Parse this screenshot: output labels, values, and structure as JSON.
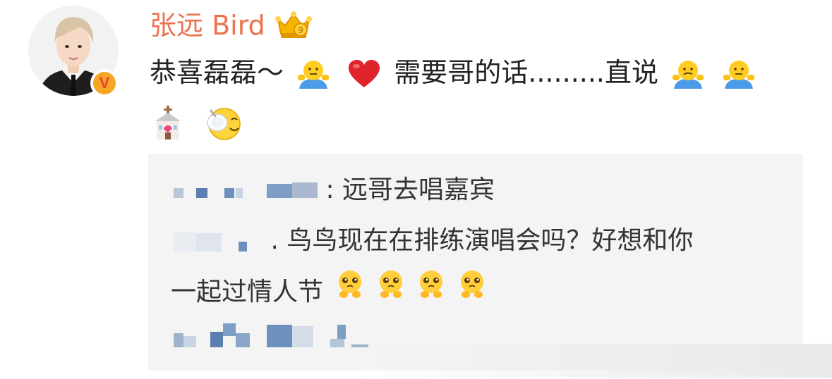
{
  "post": {
    "author": "张远 Bird",
    "text_line1_a": "恭喜磊磊～",
    "text_line1_b": "需要哥的话.........直说",
    "icons": {
      "crown": "crown-badge-icon",
      "verified": "verified-v-icon",
      "shrug": "shrug-emoji-icon",
      "heart": "red-heart-icon",
      "wedding": "wedding-chapel-icon",
      "eating": "eating-emoji-icon"
    },
    "verified_label": "V"
  },
  "repost": {
    "comment1_text": ": 远哥去唱嘉宾",
    "comment2_text_line1": ". 鸟鸟现在在排练演唱会吗？好想和你",
    "comment2_text_line2": "一起过情人节",
    "pleading_icon": "pleading-emoji-icon"
  },
  "colors": {
    "username": "#eb7350",
    "text": "#222222",
    "repost_bg": "#f4f4f4",
    "blur": "#7e9ec6"
  }
}
